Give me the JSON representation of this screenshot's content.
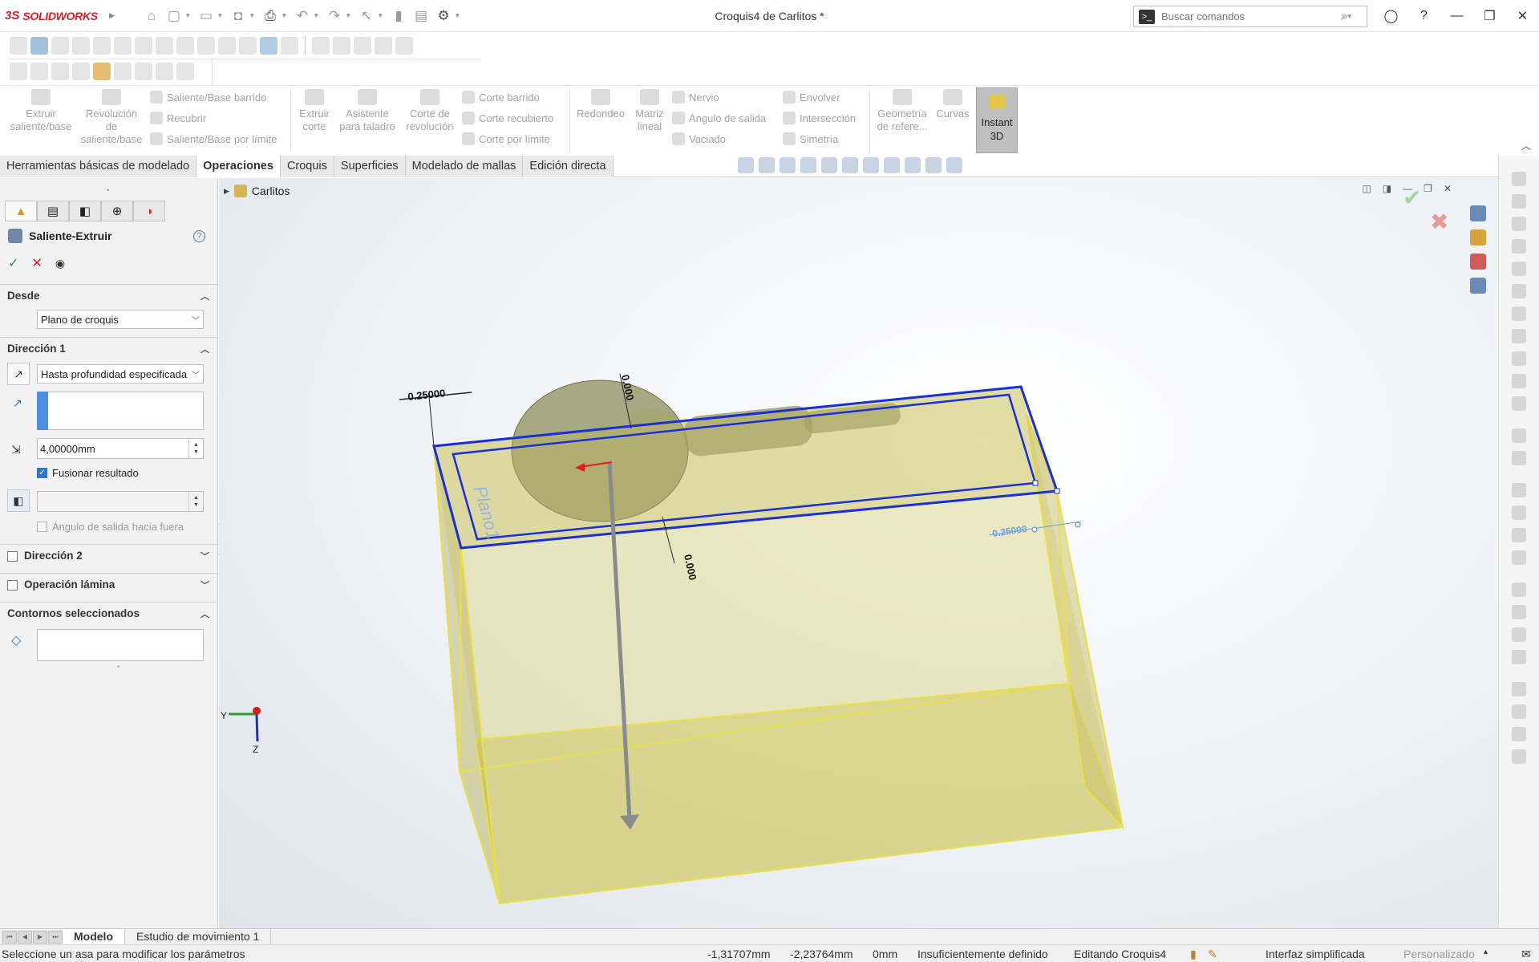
{
  "app": {
    "logo_ds": "3S",
    "logo_name": "SOLIDWORKS",
    "doc_title": "Croquis4 de Carlitos *"
  },
  "search": {
    "placeholder": "Buscar comandos"
  },
  "command_manager": {
    "extrude": "Extruir saliente/base",
    "revolve": "Revolución de saliente/base",
    "sweep": "Saliente/Base barrido",
    "loft": "Recubrir",
    "boundary": "Saliente/Base por límite",
    "cut_extrude": "Extruir corte",
    "hole_wizard": "Asistente para taladro",
    "cut_revolve": "Corte de revolución",
    "cut_sweep": "Corte barrido",
    "cut_loft": "Corte recubierto",
    "cut_boundary": "Corte por límite",
    "fillet": "Redondeo",
    "linear_pattern": "Matriz lineal",
    "rib": "Nervio",
    "draft": "Ángulo de salida",
    "shell": "Vaciado",
    "wrap": "Envolver",
    "intersect": "Intersección",
    "mirror": "Simetría",
    "ref_geometry": "Geometría de refere...",
    "curves": "Curvas",
    "instant3d": "Instant 3D"
  },
  "tabs": [
    {
      "label": "Herramientas básicas de modelado"
    },
    {
      "label": "Operaciones"
    },
    {
      "label": "Croquis"
    },
    {
      "label": "Superficies"
    },
    {
      "label": "Modelado de mallas"
    },
    {
      "label": "Edición directa"
    }
  ],
  "property_manager": {
    "title": "Saliente-Extruir",
    "help": "?",
    "from_section": "Desde",
    "from_value": "Plano de croquis",
    "dir1_section": "Dirección 1",
    "dir1_type": "Hasta profundidad especificada",
    "depth": "4,00000mm",
    "merge_result": "Fusionar resultado",
    "draft_outward": "Ángulo de salida hacia fuera",
    "dir2_section": "Dirección 2",
    "thin_section": "Operación lámina",
    "contours_section": "Contornos seleccionados"
  },
  "tree": {
    "root": "Carlitos"
  },
  "viewport": {
    "plane_label": "Plano1",
    "dim_top_left": "0.25000",
    "dim_top": "0.000",
    "dim_bottom": "0.000",
    "dim_right": "0.25000",
    "axis_x": "Y",
    "axis_z": "Z"
  },
  "bottom_tabs": [
    {
      "label": "Modelo"
    },
    {
      "label": "Estudio de movimiento 1"
    }
  ],
  "status": {
    "hint": "Seleccione un asa para modificar los parámetros",
    "x": "-1,31707mm",
    "y": "-2,23764mm",
    "z": "0mm",
    "definition": "Insuficientemente definido",
    "editing": "Editando Croquis4",
    "interface": "Interfaz simplificada",
    "custom": "Personalizado"
  },
  "colors": {
    "accent_blue": "#1a2fd0",
    "box_yellow": "#e8e04a",
    "brand_red": "#d0202a"
  }
}
